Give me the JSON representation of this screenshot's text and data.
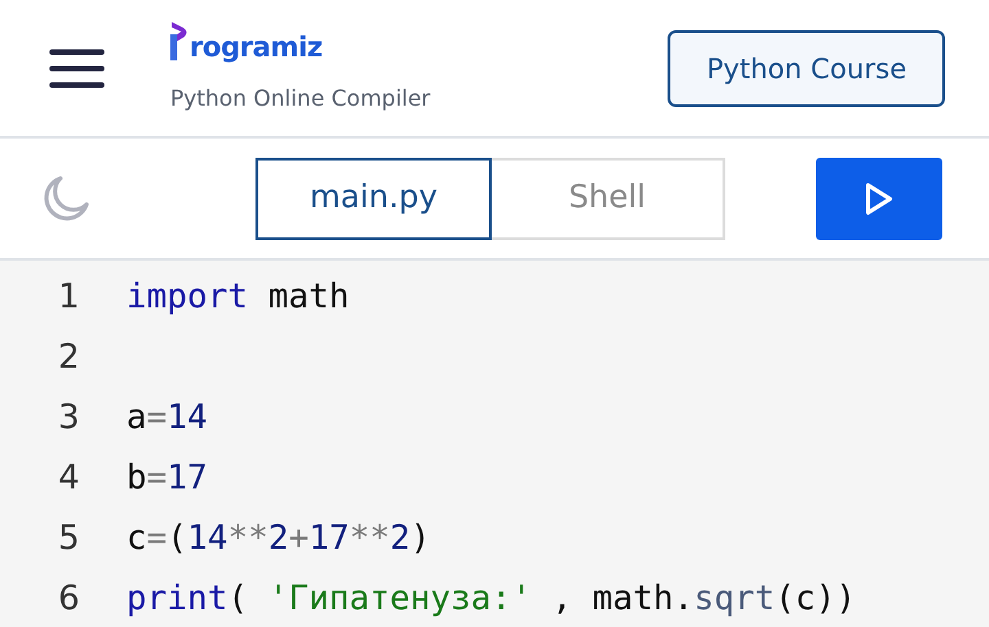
{
  "header": {
    "brand": "rogramiz",
    "subtitle": "Python Online Compiler",
    "course_button": "Python Course"
  },
  "toolbar": {
    "tabs": [
      {
        "label": "main.py",
        "selected": true
      },
      {
        "label": "Shell",
        "selected": false
      }
    ]
  },
  "editor": {
    "lines": [
      {
        "number": "1",
        "tokens": [
          {
            "kind": "keyword",
            "text": "import"
          },
          {
            "kind": "plain",
            "text": " math"
          }
        ]
      },
      {
        "number": "2"
      },
      {
        "number": "3",
        "tokens": [
          {
            "kind": "plain",
            "text": "a"
          },
          {
            "kind": "operator",
            "text": "="
          },
          {
            "kind": "number",
            "text": "14"
          }
        ]
      },
      {
        "number": "4",
        "tokens": [
          {
            "kind": "plain",
            "text": "b"
          },
          {
            "kind": "operator",
            "text": "="
          },
          {
            "kind": "number",
            "text": "17"
          }
        ]
      },
      {
        "number": "5",
        "tokens": [
          {
            "kind": "plain",
            "text": "c"
          },
          {
            "kind": "operator",
            "text": "="
          },
          {
            "kind": "plain",
            "text": "("
          },
          {
            "kind": "number",
            "text": "14"
          },
          {
            "kind": "operator",
            "text": "**"
          },
          {
            "kind": "number",
            "text": "2"
          },
          {
            "kind": "operator",
            "text": "+"
          },
          {
            "kind": "number",
            "text": "17"
          },
          {
            "kind": "operator",
            "text": "**"
          },
          {
            "kind": "number",
            "text": "2"
          },
          {
            "kind": "plain",
            "text": ")"
          }
        ]
      },
      {
        "number": "6",
        "tokens": [
          {
            "kind": "keyword",
            "text": "print"
          },
          {
            "kind": "plain",
            "text": "( "
          },
          {
            "kind": "string",
            "text": "'Гипатенуза:'"
          },
          {
            "kind": "plain",
            "text": " , math."
          },
          {
            "kind": "property",
            "text": "sqrt"
          },
          {
            "kind": "plain",
            "text": "(c))"
          }
        ]
      }
    ]
  }
}
